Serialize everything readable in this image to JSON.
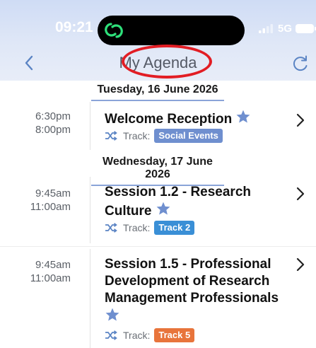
{
  "status_bar": {
    "time": "09:21",
    "network": "5G"
  },
  "nav": {
    "title": "My Agenda"
  },
  "colors": {
    "accent": "#5b84c4",
    "star": "#6f8fcf",
    "highlight_ring": "#e21d24"
  },
  "days": [
    {
      "header": "Tuesday, 16 June 2026",
      "sessions": [
        {
          "start": "6:30pm",
          "end": "8:00pm",
          "title": "Welcome Reception",
          "starred": true,
          "track_label": "Track:",
          "track": "Social Events",
          "track_color": "#6f8fcf"
        }
      ]
    },
    {
      "header": "Wednesday, 17 June 2026",
      "sessions": [
        {
          "start": "9:45am",
          "end": "11:00am",
          "title_lines": [
            "Session 1.2 - Research",
            "Culture"
          ],
          "starred": true,
          "track_label": "Track:",
          "track": "Track 2",
          "track_color": "#3a8fd6"
        },
        {
          "start": "9:45am",
          "end": "11:00am",
          "title_lines": [
            "Session 1.5 - Professional",
            "Development of Research",
            "Management Professionals"
          ],
          "starred": true,
          "track_label": "Track:",
          "track": "Track 5",
          "track_color": "#e8743b"
        }
      ]
    }
  ]
}
